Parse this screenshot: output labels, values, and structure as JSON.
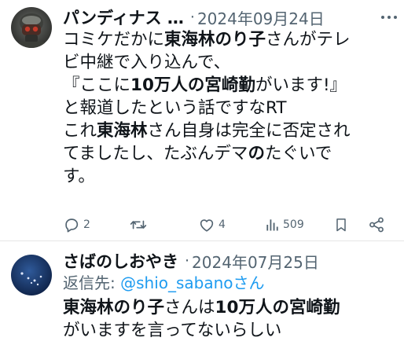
{
  "posts": [
    {
      "author": "パンディナス …",
      "separator": "·",
      "date": "2024年09月24日",
      "lines": [
        [
          {
            "t": "コミケだかに"
          },
          {
            "t": "東海林のり子",
            "b": true
          },
          {
            "t": "さんがテレ"
          }
        ],
        [
          {
            "t": "ビ中継で入り込んで、"
          }
        ],
        [
          {
            "t": "『ここに"
          },
          {
            "t": "10万人の宮崎勤",
            "b": true
          },
          {
            "t": "がいます!』"
          }
        ],
        [
          {
            "t": "と報道したという話ですなRT"
          }
        ],
        [
          {
            "t": "これ"
          },
          {
            "t": "東海林",
            "b": true
          },
          {
            "t": "さん自身は完全に否定され"
          }
        ],
        [
          {
            "t": "てましたし、たぶんデマ"
          },
          {
            "t": "の",
            "b": true
          },
          {
            "t": "たぐいで"
          }
        ],
        [
          {
            "t": "す。"
          }
        ]
      ],
      "actions": {
        "reply_count": "2",
        "repost_count": "",
        "like_count": "4",
        "views_count": "509"
      }
    },
    {
      "author": "さばのしおやき",
      "separator": "·",
      "date": "2024年07月25日",
      "reply_prefix": "返信先: ",
      "reply_mention": "@shio_sabanoさん",
      "lines": [
        [
          {
            "t": "東海林のり子",
            "b": true
          },
          {
            "t": "さんは"
          },
          {
            "t": "10万人の宮崎勤",
            "b": true
          }
        ],
        [
          {
            "t": "がいますを言ってないらしい"
          }
        ]
      ]
    }
  ],
  "icons": {
    "reply": "reply-bubble-icon",
    "repost": "repost-arrows-icon",
    "like": "heart-icon",
    "views": "views-bar-chart-icon",
    "bookmark": "bookmark-icon",
    "share": "share-icon",
    "more": "more-dots-icon"
  },
  "colors": {
    "text": "#0f1419",
    "secondary": "#536471",
    "link": "#1d9bf0",
    "divider": "#e6e6e6"
  }
}
